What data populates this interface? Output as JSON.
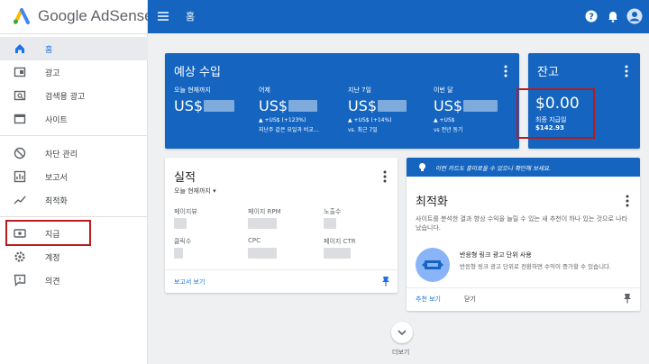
{
  "app": {
    "name_google": "Google",
    "name_product": "AdSense"
  },
  "sidebar": {
    "items": [
      {
        "label": "홈",
        "icon": "home-icon",
        "active": true
      },
      {
        "label": "광고",
        "icon": "ads-icon"
      },
      {
        "label": "검색용 광고",
        "icon": "search-ads-icon"
      },
      {
        "label": "사이트",
        "icon": "sites-icon"
      },
      {
        "label": "차단 관리",
        "icon": "block-icon"
      },
      {
        "label": "보고서",
        "icon": "reports-icon"
      },
      {
        "label": "최적화",
        "icon": "optimization-icon"
      },
      {
        "label": "지급",
        "icon": "payments-icon"
      },
      {
        "label": "계정",
        "icon": "gear-icon"
      },
      {
        "label": "의견",
        "icon": "feedback-icon"
      }
    ]
  },
  "header": {
    "title": "홈"
  },
  "earnings": {
    "title": "예상 수입",
    "columns": [
      {
        "label": "오늘 현재까지",
        "value": "US$",
        "delta": "",
        "compare": ""
      },
      {
        "label": "어제",
        "value": "US$",
        "delta": "▲ +US$ (+123%)",
        "compare": "지난주 같은 요일과 비교..."
      },
      {
        "label": "지난 7일",
        "value": "US$",
        "delta": "▲ +US$ (+14%)",
        "compare": "vs. 최근 7일"
      },
      {
        "label": "이번 달",
        "value": "US$",
        "delta": "▲ +US$",
        "compare": "vs 전년 동기"
      }
    ]
  },
  "balance": {
    "title": "잔고",
    "amount": "$0.00",
    "last_payment_label": "최종 지급일",
    "last_payment_amount": "$142.93"
  },
  "performance": {
    "title": "실적",
    "range": "오늘 현재까지",
    "metrics": [
      "페이지뷰",
      "페이지 RPM",
      "노출수",
      "클릭수",
      "CPC",
      "페이지 CTR"
    ],
    "link": "보고서 보기"
  },
  "optimization": {
    "banner": "이런 카드도 흥미로울 수 있으니 확인해 보세요.",
    "title": "최적화",
    "description": "사이트를 분석한 결과 향상 수익을 늘릴 수 있는 새 추천이 하나 있는 것으로 나타났습니다.",
    "item_title": "반응형 링크 광고 단위 사용",
    "item_desc": "반응형 링크 광고 단위로 전환하면 수익이 증가할 수 있습니다.",
    "action_recommend": "추천 보기",
    "action_close": "닫기"
  },
  "footer": {
    "more": "더보기"
  },
  "colors": {
    "brand_blue": "#1565c0",
    "highlight_red": "#b71c1c"
  }
}
